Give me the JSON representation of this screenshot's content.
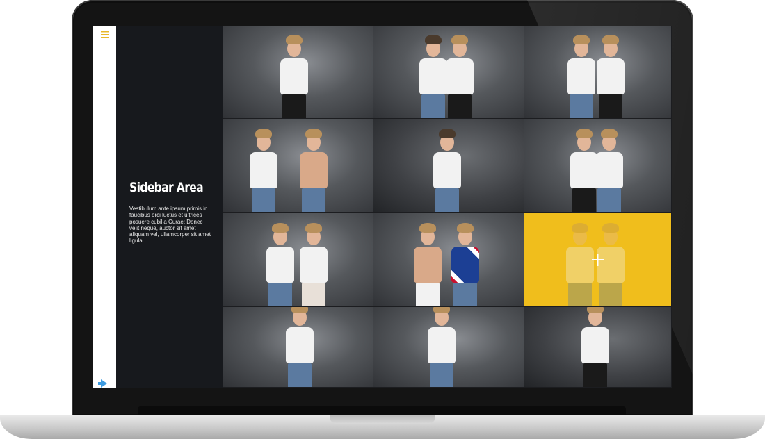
{
  "sidebar": {
    "title": "Sidebar Area",
    "text": "Vestibulum ante ipsum primis in faucibus orci luctus et ultrices posuere cubilia Curae; Donec velit neque, auctor sit amet aliquam vel, ullamcorper sit amet ligula."
  },
  "menu": {
    "toggle_icon": "hamburger-icon",
    "bottom_icon": "arrow-right-icon"
  },
  "gallery": {
    "columns": 3,
    "rows": 4,
    "hover_tile": 8,
    "hover_icon": "plus-icon"
  },
  "colors": {
    "accent": "#f0be1c",
    "sidebar_bg": "#17191d",
    "menu_icon": "#e8b82a",
    "arrow_icon": "#3d9be0"
  }
}
